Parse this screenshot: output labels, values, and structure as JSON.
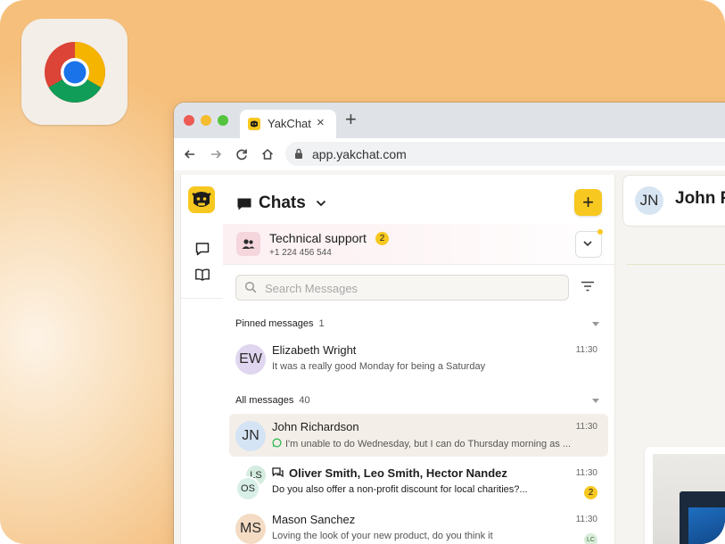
{
  "colors": {
    "brand_yellow": "#f7c820",
    "background_orange": "#f6c07c"
  },
  "desktop": {
    "dock_icon": "chrome-icon"
  },
  "browser": {
    "tab_title": "YakChat",
    "tab_close": "×",
    "new_tab": "+",
    "url": "app.yakchat.com"
  },
  "rail": {
    "items": [
      "chat-bubble-icon",
      "book-icon"
    ]
  },
  "panel": {
    "title": "Chats",
    "add_button": "+",
    "inbox": {
      "name": "Technical support",
      "badge": "2",
      "phone": "+1 224 456 544"
    },
    "search": {
      "placeholder": "Search Messages"
    },
    "pinned_section": {
      "label": "Pinned messages",
      "count": "1"
    },
    "all_section": {
      "label": "All messages",
      "count": "40"
    },
    "pinned": [
      {
        "initials": "EW",
        "name": "Elizabeth Wright",
        "snippet": "It was a really good Monday for being a Saturday",
        "time": "11:30"
      }
    ],
    "messages": [
      {
        "initials": "JN",
        "name": "John Richardson",
        "snippet": "I'm unable to do Wednesday, but I can do Thursday morning as ...",
        "time": "11:30",
        "channel": "whatsapp-icon"
      },
      {
        "initials_back": "LS",
        "initials_front": "OS",
        "name": "Oliver Smith, Leo Smith, Hector Nandez",
        "snippet": "Do you also offer a non-profit discount for local charities?...",
        "time": "11:30",
        "badge": "2",
        "channel": "group-chat-icon"
      },
      {
        "initials": "MS",
        "name": "Mason Sanchez",
        "snippet": "Loving the look of your new product, do you think it",
        "time": "11:30",
        "mini_badge": "LC"
      }
    ]
  },
  "conversation": {
    "initials": "JN",
    "name": "John R"
  }
}
